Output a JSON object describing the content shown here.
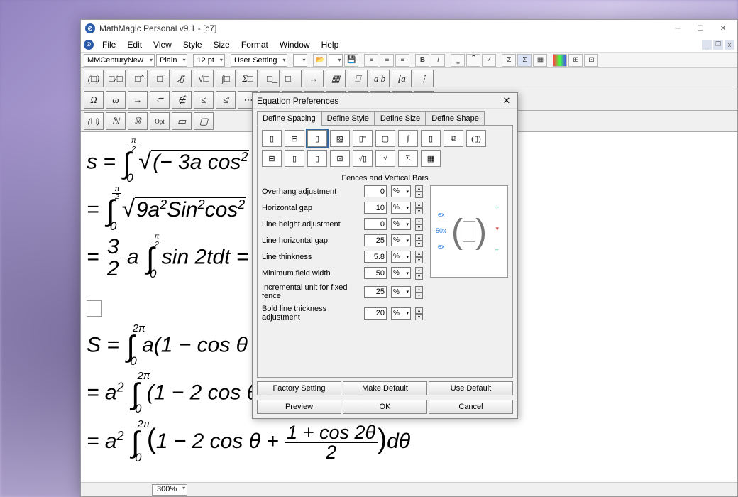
{
  "title": "MathMagic Personal v9.1 - [c7]",
  "menus": [
    "File",
    "Edit",
    "View",
    "Style",
    "Size",
    "Format",
    "Window",
    "Help"
  ],
  "toolbar": {
    "font": "MMCenturyNew",
    "style": "Plain",
    "size_label": "12 pt",
    "user_setting": "User Setting"
  },
  "palette1": [
    "(□)",
    "□/□",
    "□̂",
    "□̅",
    "▯̸",
    "√□",
    "∫□",
    "Σ□",
    "□͟",
    "□⃗",
    "→",
    "▦",
    "⎕",
    "a b",
    "⌊a",
    "⋮"
  ],
  "palette2": [
    "Ω",
    "ω",
    "→",
    "⊂",
    "∉",
    "≤",
    "≰",
    "⋯",
    "∂",
    "∞",
    "↔",
    "⊗",
    "∀",
    "·",
    "△",
    "□"
  ],
  "palette3": [
    "(□)",
    "ℕ",
    "ℝ",
    "Opt",
    "▭",
    "▢"
  ],
  "math": {
    "l1": "s = ∫₀^{π/2} √((−3a cos²…",
    "l2": "= ∫₀^{π/2} √(9a² Sin² cos²…",
    "l3": "= (3/2) a ∫₀^{π/2} sin 2t dt = …",
    "l4": "S = ∫₀^{2π} a(1 − cos θ…",
    "l5": "= a² ∫₀^{2π} (1 − 2 cos θ…",
    "l6": "= a² ∫₀^{2π} (1 − 2 cos θ + (1+cos 2θ)/2) dθ"
  },
  "zoom": "300%",
  "dialog": {
    "title": "Equation Preferences",
    "tabs": [
      "Define Spacing",
      "Define Style",
      "Define Size",
      "Define Shape"
    ],
    "section": "Fences and Vertical Bars",
    "rows": [
      {
        "label": "Overhang adjustment",
        "value": "0",
        "unit": "%"
      },
      {
        "label": "Horizontal gap",
        "value": "10",
        "unit": "%"
      },
      {
        "label": "Line height adjustment",
        "value": "0",
        "unit": "%"
      },
      {
        "label": "Line horizontal gap",
        "value": "25",
        "unit": "%"
      },
      {
        "label": "Line thinkness",
        "value": "5.8",
        "unit": "%"
      },
      {
        "label": "Minimum field width",
        "value": "50",
        "unit": "%"
      },
      {
        "label": "Incremental unit for fixed fence",
        "value": "25",
        "unit": "%"
      },
      {
        "label": "Bold line thickness adjustment",
        "value": "20",
        "unit": "%"
      }
    ],
    "preview": {
      "left": "ex",
      "mid": "-50x",
      "right": "ex"
    },
    "buttons_top": [
      "Factory Setting",
      "Make Default",
      "Use Default"
    ],
    "buttons_bot": [
      "Preview",
      "OK",
      "Cancel"
    ]
  }
}
